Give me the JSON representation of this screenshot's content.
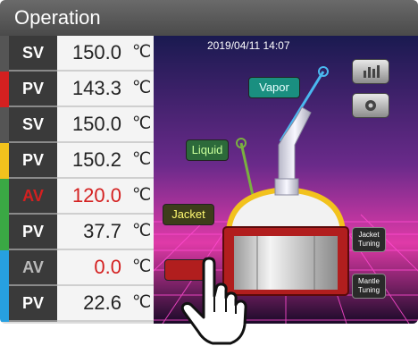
{
  "header": {
    "title": "Operation"
  },
  "readings": [
    {
      "label": "SV",
      "value": "150.0",
      "unit": "℃",
      "stripe": "#555555",
      "state": "normal"
    },
    {
      "label": "PV",
      "value": "143.3",
      "unit": "℃",
      "stripe": "#d42020",
      "state": "normal"
    },
    {
      "label": "SV",
      "value": "150.0",
      "unit": "℃",
      "stripe": "#555555",
      "state": "normal"
    },
    {
      "label": "PV",
      "value": "150.2",
      "unit": "℃",
      "stripe": "#f2c21d",
      "state": "normal"
    },
    {
      "label": "AV",
      "value": "120.0",
      "unit": "℃",
      "stripe": "#3aa844",
      "state": "alert"
    },
    {
      "label": "PV",
      "value": "37.7",
      "unit": "℃",
      "stripe": "#3aa844",
      "state": "normal"
    },
    {
      "label": "AV",
      "value": "0.0",
      "unit": "℃",
      "stripe": "#27a0e0",
      "state": "inactive"
    },
    {
      "label": "PV",
      "value": "22.6",
      "unit": "℃",
      "stripe": "#27a0e0",
      "state": "normal"
    }
  ],
  "scene": {
    "datetime": "2019/04/11 14:07",
    "labels": {
      "vapor": "Vapor",
      "liquid": "Liquid",
      "jacket": "Jacket"
    },
    "buttons": {
      "jacket_tuning": [
        "Jacket",
        "Tuning"
      ],
      "mantle_tuning": [
        "Mantle",
        "Tuning"
      ]
    },
    "colors": {
      "vapor": "#1a8f80",
      "liquid": "#2c6a3a",
      "jacket": "#f2c21d",
      "mantle": "#b11e1e"
    }
  }
}
